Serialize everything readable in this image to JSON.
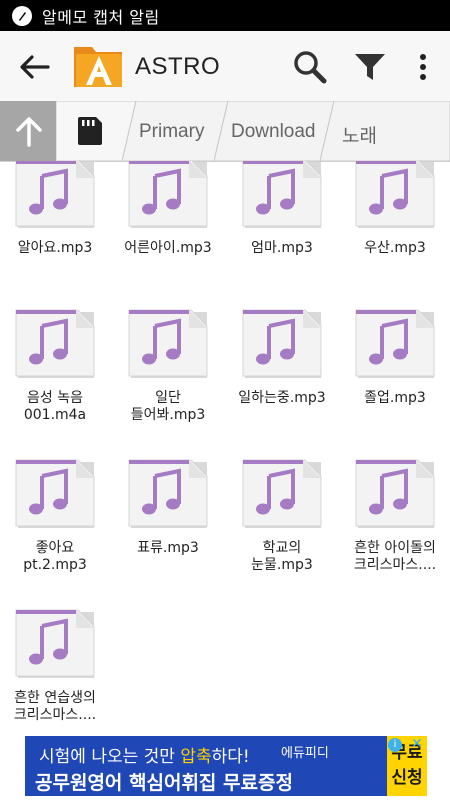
{
  "status_bar": {
    "notification_title": "알메모 캡처 알림"
  },
  "app_bar": {
    "title": "ASTRO",
    "icons": [
      "back-arrow-icon",
      "astro-logo-icon",
      "search-icon",
      "filter-icon",
      "more-vert-icon"
    ]
  },
  "path_bar": {
    "crumbs": [
      {
        "label": "",
        "icon": "sd-card-icon"
      },
      {
        "label": "Primary"
      },
      {
        "label": "Download"
      },
      {
        "label": "노래"
      }
    ]
  },
  "files": [
    {
      "name_line1": "알아요.mp3",
      "name_line2": ""
    },
    {
      "name_line1": "어른아이.mp3",
      "name_line2": ""
    },
    {
      "name_line1": "엄마.mp3",
      "name_line2": ""
    },
    {
      "name_line1": "우산.mp3",
      "name_line2": ""
    },
    {
      "name_line1": "음성 녹음",
      "name_line2": "001.m4a"
    },
    {
      "name_line1": "일단",
      "name_line2": "들어봐.mp3"
    },
    {
      "name_line1": "일하는중.mp3",
      "name_line2": ""
    },
    {
      "name_line1": "졸업.mp3",
      "name_line2": ""
    },
    {
      "name_line1": "좋아요",
      "name_line2": "pt.2.mp3"
    },
    {
      "name_line1": "표류.mp3",
      "name_line2": ""
    },
    {
      "name_line1": "학교의",
      "name_line2": "눈물.mp3"
    },
    {
      "name_line1": "흔한 아이돌의",
      "name_line2": "크리스마스...."
    },
    {
      "name_line1": "흔한 연습생의",
      "name_line2": "크리스마스...."
    }
  ],
  "ad": {
    "line1_pre": "시험에 나오는 것만 ",
    "line1_hl": "압축",
    "line1_post": "하다!",
    "line2": "공무원영어 핵심어휘집 무료증정",
    "brand": "에듀피디",
    "cta_line1": "무료",
    "cta_line2": "신청",
    "info": "i",
    "close": "✕"
  },
  "colors": {
    "status_bar": "#000000",
    "app_bar": "#f7f7f7",
    "path_bar": "#e9e9e9",
    "up_button": "#a6a6a6",
    "logo_orange": "#f39c1e",
    "file_accent": "#a57bc4",
    "ad_blue": "#1f47b5",
    "ad_yellow": "#ffd400"
  }
}
